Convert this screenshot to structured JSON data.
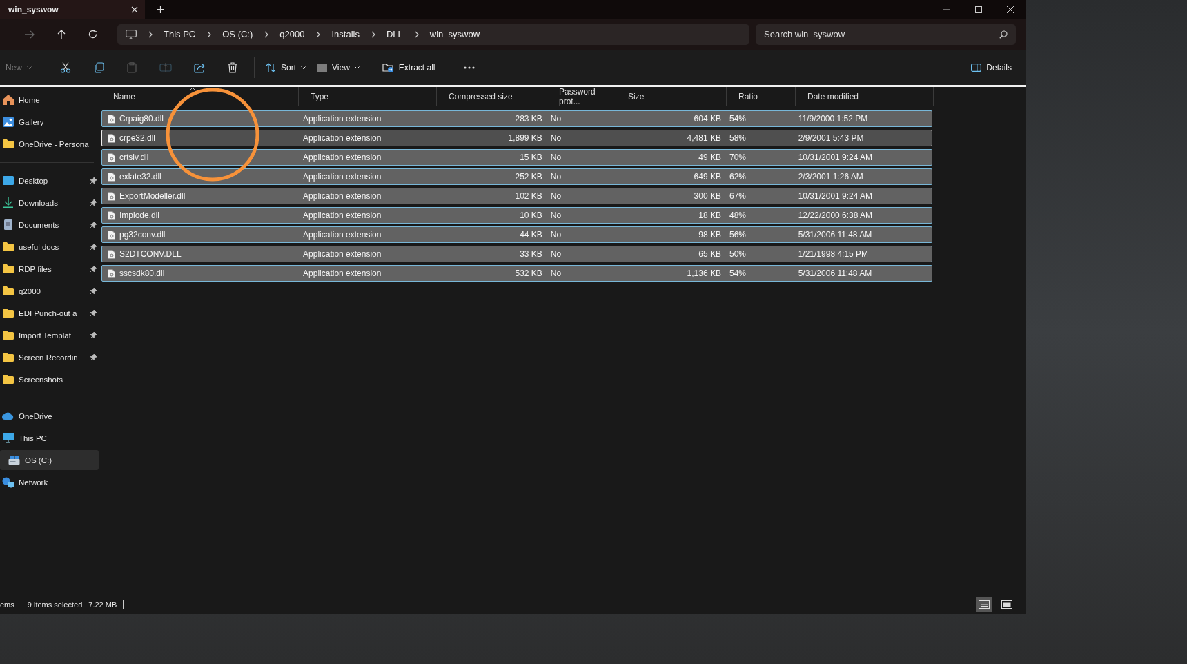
{
  "tab": {
    "title": "win_syswow"
  },
  "nav": {
    "forward_disabled": true
  },
  "breadcrumbs": [
    "This PC",
    "OS (C:)",
    "q2000",
    "Installs",
    "DLL",
    "win_syswow"
  ],
  "search": {
    "placeholder": "Search win_syswow"
  },
  "toolbar": {
    "new": {
      "label": "New",
      "disabled": true
    },
    "actions": [
      {
        "disabled": false
      },
      {
        "disabled": false
      },
      {
        "disabled": true
      },
      {
        "disabled": true
      },
      {
        "disabled": false
      },
      {
        "disabled": false
      }
    ],
    "sort": "Sort",
    "view": "View",
    "extract": "Extract all",
    "details": "Details"
  },
  "sidebar": {
    "sections": [
      {
        "items": [
          {
            "label": "Home",
            "pinned": false,
            "selected": false
          },
          {
            "label": "Gallery",
            "pinned": false,
            "selected": false
          },
          {
            "label": "OneDrive - Persona",
            "pinned": false,
            "selected": false
          }
        ]
      },
      {
        "items": [
          {
            "label": "Desktop",
            "pinned": true,
            "selected": false
          },
          {
            "label": "Downloads",
            "pinned": true,
            "selected": false
          },
          {
            "label": "Documents",
            "pinned": true,
            "selected": false
          },
          {
            "label": "useful docs",
            "pinned": true,
            "selected": false
          },
          {
            "label": "RDP files",
            "pinned": true,
            "selected": false
          },
          {
            "label": "q2000",
            "pinned": true,
            "selected": false
          },
          {
            "label": "EDI Punch-out a",
            "pinned": true,
            "selected": false
          },
          {
            "label": "Import Templat",
            "pinned": true,
            "selected": false
          },
          {
            "label": "Screen Recordin",
            "pinned": true,
            "selected": false
          },
          {
            "label": "Screenshots",
            "pinned": false,
            "selected": false
          }
        ]
      },
      {
        "items": [
          {
            "label": "OneDrive",
            "pinned": false,
            "selected": false
          },
          {
            "label": "This PC",
            "pinned": false,
            "selected": false,
            "children": [
              {
                "label": "OS (C:)",
                "selected": true
              }
            ]
          },
          {
            "label": "Network",
            "pinned": false,
            "selected": false
          }
        ]
      }
    ]
  },
  "table": {
    "columns": [
      {
        "label": "Name",
        "sorted": true
      },
      {
        "label": "Type",
        "sorted": false
      },
      {
        "label": "Compressed size",
        "sorted": false
      },
      {
        "label": "Password prot...",
        "sorted": false
      },
      {
        "label": "Size",
        "sorted": false
      },
      {
        "label": "Ratio",
        "sorted": false
      },
      {
        "label": "Date modified",
        "sorted": false
      }
    ],
    "rows": [
      {
        "cells": [
          "Crpaig80.dll",
          "Application extension",
          "283 KB",
          "No",
          "604 KB",
          "54%",
          "11/9/2000 1:52 PM"
        ],
        "selected": true,
        "focused": false
      },
      {
        "cells": [
          "crpe32.dll",
          "Application extension",
          "1,899 KB",
          "No",
          "4,481 KB",
          "58%",
          "2/9/2001 5:43 PM"
        ],
        "selected": true,
        "focused": true
      },
      {
        "cells": [
          "crtslv.dll",
          "Application extension",
          "15 KB",
          "No",
          "49 KB",
          "70%",
          "10/31/2001 9:24 AM"
        ],
        "selected": true,
        "focused": false
      },
      {
        "cells": [
          "exlate32.dll",
          "Application extension",
          "252 KB",
          "No",
          "649 KB",
          "62%",
          "2/3/2001 1:26 AM"
        ],
        "selected": true,
        "focused": false
      },
      {
        "cells": [
          "ExportModeller.dll",
          "Application extension",
          "102 KB",
          "No",
          "300 KB",
          "67%",
          "10/31/2001 9:24 AM"
        ],
        "selected": true,
        "focused": false
      },
      {
        "cells": [
          "Implode.dll",
          "Application extension",
          "10 KB",
          "No",
          "18 KB",
          "48%",
          "12/22/2000 6:38 AM"
        ],
        "selected": true,
        "focused": false
      },
      {
        "cells": [
          "pg32conv.dll",
          "Application extension",
          "44 KB",
          "No",
          "98 KB",
          "56%",
          "5/31/2006 11:48 AM"
        ],
        "selected": true,
        "focused": false
      },
      {
        "cells": [
          "S2DTCONV.DLL",
          "Application extension",
          "33 KB",
          "No",
          "65 KB",
          "50%",
          "1/21/1998 4:15 PM"
        ],
        "selected": true,
        "focused": false
      },
      {
        "cells": [
          "sscsdk80.dll",
          "Application extension",
          "532 KB",
          "No",
          "1,136 KB",
          "54%",
          "5/31/2006 11:48 AM"
        ],
        "selected": true,
        "focused": false
      }
    ]
  },
  "status_bar": {
    "count": "ems",
    "selected": "9 items selected",
    "size": "7.22 MB",
    "views": [
      {
        "selected": true
      },
      {
        "selected": false
      }
    ]
  }
}
